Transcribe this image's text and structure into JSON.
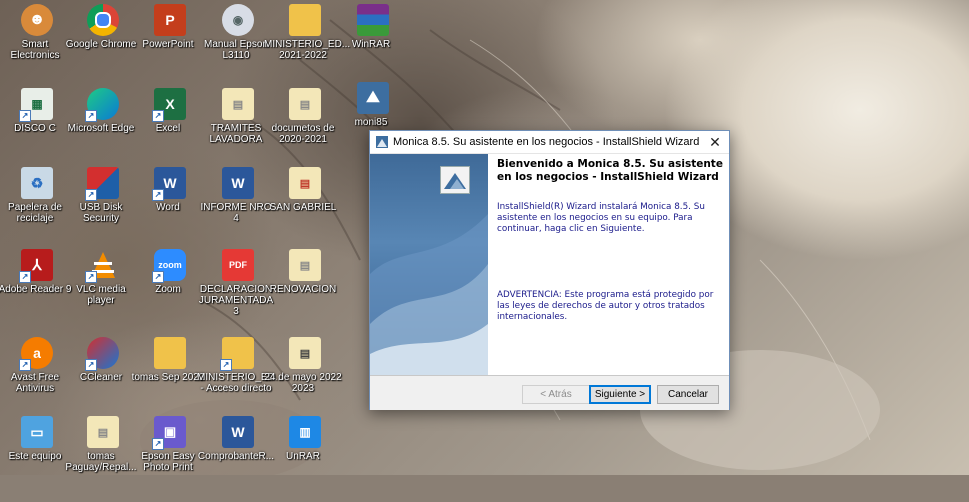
{
  "desktop": {
    "icons": [
      {
        "label": "Smart Electronics"
      },
      {
        "label": "Google Chrome"
      },
      {
        "label": "PowerPoint"
      },
      {
        "label": "Manual Epson L3110"
      },
      {
        "label": "MINISTERIO_ED... 2021-2022"
      },
      {
        "label": "WinRAR"
      },
      {
        "label": "DISCO C"
      },
      {
        "label": "Microsoft Edge"
      },
      {
        "label": "Excel"
      },
      {
        "label": "TRAMITES LAVADORA"
      },
      {
        "label": "documetos de 2020-2021"
      },
      {
        "label": "moni85"
      },
      {
        "label": "Papelera de reciclaje"
      },
      {
        "label": "USB Disk Security"
      },
      {
        "label": "Word"
      },
      {
        "label": "INFORME NRO 4"
      },
      {
        "label": "SAN GABRIEL"
      },
      {
        "label": "Adobe Reader 9"
      },
      {
        "label": "VLC media player"
      },
      {
        "label": "Zoom"
      },
      {
        "label": "DECLARACION JURAMENTADA 3"
      },
      {
        "label": "RENOVACION"
      },
      {
        "label": "Avast Free Antivirus"
      },
      {
        "label": "CCleaner"
      },
      {
        "label": "tomas Sep 2022"
      },
      {
        "label": "MINISTERIO_ED... - Acceso directo"
      },
      {
        "label": "24 de mayo 2022 2023"
      },
      {
        "label": "Este equipo"
      },
      {
        "label": "tomas Paguay/Repal..."
      },
      {
        "label": "Epson Easy Photo Print"
      },
      {
        "label": "ComprobanteR..."
      },
      {
        "label": "UnRAR"
      }
    ],
    "zoom_badge": "zoom",
    "pdf_badge": "PDF",
    "word_badge": "W",
    "excel_badge": "X",
    "ppt_badge": "P"
  },
  "dialog": {
    "title": "Monica 8.5. Su asistente en los negocios - InstallShield Wizard",
    "close": "✕",
    "headline": "Bienvenido a Monica 8.5. Su asistente en los negocios - InstallShield Wizard",
    "intro": "InstallShield(R) Wizard instalará Monica 8.5. Su asistente en los negocios en su equipo. Para continuar, haga clic en Siguiente.",
    "warning": "ADVERTENCIA: Este programa está protegido por las leyes de derechos de autor y otros tratados internacionales.",
    "buttons": {
      "back": "< Atrás",
      "next": "Siguiente >",
      "cancel": "Cancelar"
    }
  },
  "colors": {
    "accent": "#0078d7",
    "body_text": "#1a1a8a",
    "panel_blue": "#4a78a8"
  }
}
